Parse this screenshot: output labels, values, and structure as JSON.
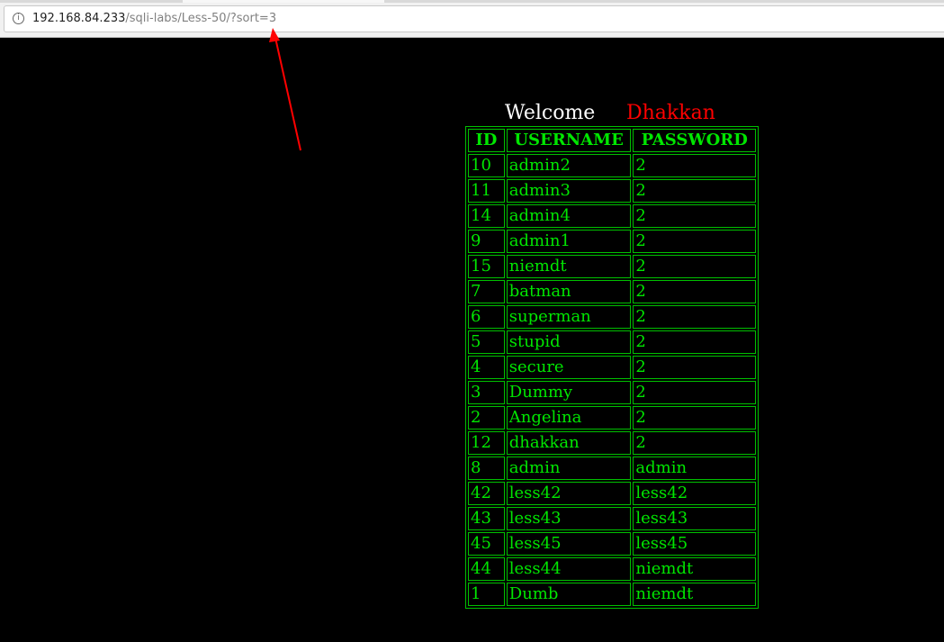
{
  "browser": {
    "url_host": "192.168.84.233",
    "url_path": "/sqli-labs/Less-50/?sort=3",
    "info_icon": "info-icon"
  },
  "colors": {
    "background": "#000000",
    "welcome_text": "#ffffff",
    "name_text": "#ff0000",
    "table_text": "#00e600",
    "annotation_arrow": "#ff0000"
  },
  "welcome": {
    "greeting": "Welcome",
    "name": "Dhakkan"
  },
  "table": {
    "headers": [
      "ID",
      "USERNAME",
      "PASSWORD"
    ],
    "rows": [
      [
        "10",
        "admin2",
        "2"
      ],
      [
        "11",
        "admin3",
        "2"
      ],
      [
        "14",
        "admin4",
        "2"
      ],
      [
        "9",
        "admin1",
        "2"
      ],
      [
        "15",
        "niemdt",
        "2"
      ],
      [
        "7",
        "batman",
        "2"
      ],
      [
        "6",
        "superman",
        "2"
      ],
      [
        "5",
        "stupid",
        "2"
      ],
      [
        "4",
        "secure",
        "2"
      ],
      [
        "3",
        "Dummy",
        "2"
      ],
      [
        "2",
        "Angelina",
        "2"
      ],
      [
        "12",
        "dhakkan",
        "2"
      ],
      [
        "8",
        "admin",
        "admin"
      ],
      [
        "42",
        "less42",
        "less42"
      ],
      [
        "43",
        "less43",
        "less43"
      ],
      [
        "45",
        "less45",
        "less45"
      ],
      [
        "44",
        "less44",
        "niemdt"
      ],
      [
        "1",
        "Dumb",
        "niemdt"
      ]
    ]
  }
}
